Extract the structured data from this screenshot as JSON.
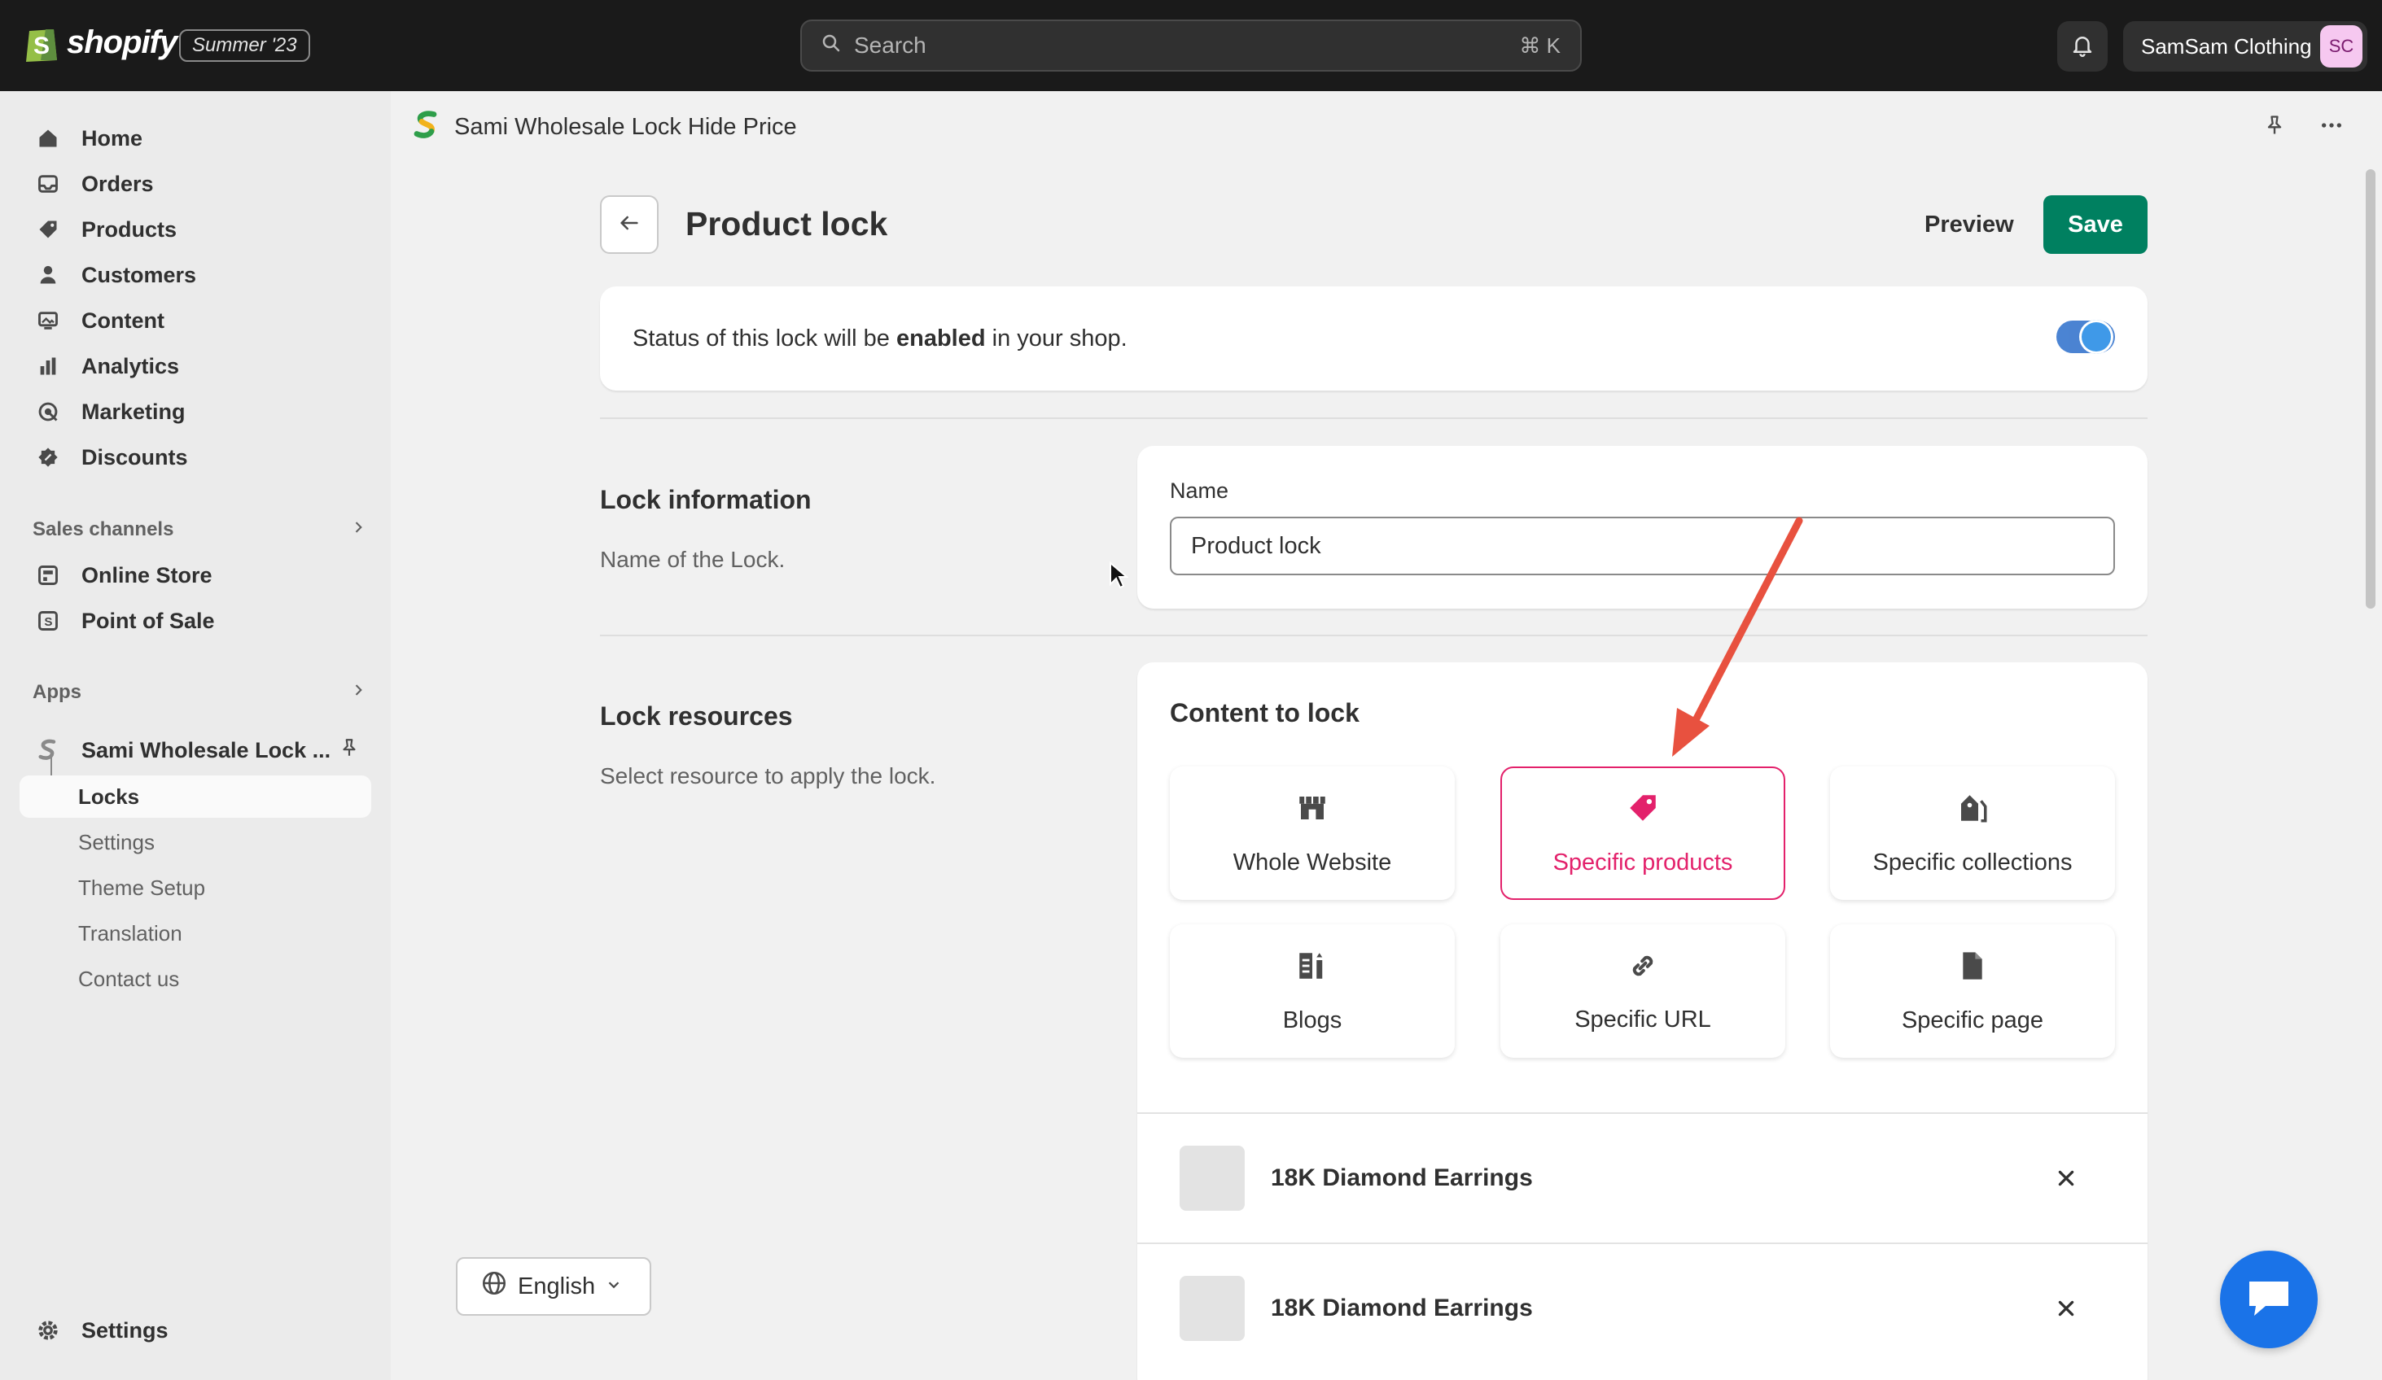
{
  "topbar": {
    "brand": "shopify",
    "edition": "Summer '23",
    "search_placeholder": "Search",
    "search_shortcut": "⌘ K",
    "store_name": "SamSam Clothing",
    "avatar_initials": "SC"
  },
  "sidebar": {
    "items": [
      {
        "label": "Home",
        "icon": "home-icon"
      },
      {
        "label": "Orders",
        "icon": "inbox-icon"
      },
      {
        "label": "Products",
        "icon": "tag-icon"
      },
      {
        "label": "Customers",
        "icon": "person-icon"
      },
      {
        "label": "Content",
        "icon": "image-icon"
      },
      {
        "label": "Analytics",
        "icon": "bar-chart-icon"
      },
      {
        "label": "Marketing",
        "icon": "target-icon"
      },
      {
        "label": "Discounts",
        "icon": "discount-icon"
      }
    ],
    "sales_channels_label": "Sales channels",
    "sales_channels": [
      {
        "label": "Online Store",
        "icon": "store-icon"
      },
      {
        "label": "Point of Sale",
        "icon": "pos-icon"
      }
    ],
    "apps_label": "Apps",
    "app_name": "Sami Wholesale Lock ...",
    "app_subitems": [
      "Locks",
      "Settings",
      "Theme Setup",
      "Translation",
      "Contact us"
    ],
    "settings_label": "Settings"
  },
  "appbar": {
    "title": "Sami Wholesale Lock Hide Price"
  },
  "page": {
    "title": "Product lock",
    "preview_label": "Preview",
    "save_label": "Save",
    "status_prefix": "Status of this lock will be ",
    "status_word": "enabled",
    "status_suffix": " in your shop.",
    "status_enabled": true
  },
  "lock_info": {
    "title": "Lock information",
    "desc": "Name of the Lock.",
    "name_label": "Name",
    "name_value": "Product lock"
  },
  "lock_resources": {
    "title": "Lock resources",
    "desc": "Select resource to apply the lock.",
    "content_title": "Content to lock",
    "options": [
      {
        "label": "Whole Website",
        "icon": "store-icon",
        "selected": false
      },
      {
        "label": "Specific products",
        "icon": "tag-icon",
        "selected": true
      },
      {
        "label": "Specific collections",
        "icon": "collection-icon",
        "selected": false
      },
      {
        "label": "Blogs",
        "icon": "blog-icon",
        "selected": false
      },
      {
        "label": "Specific URL",
        "icon": "link-icon",
        "selected": false
      },
      {
        "label": "Specific page",
        "icon": "page-icon",
        "selected": false
      }
    ],
    "selected_products": [
      "18K Diamond Earrings",
      "18K Diamond Earrings"
    ]
  },
  "footer": {
    "language": "English"
  },
  "colors": {
    "primary": "#008060",
    "selected": "#e3216b",
    "toggle": "#1e88e5",
    "arrow": "#e8513f"
  }
}
